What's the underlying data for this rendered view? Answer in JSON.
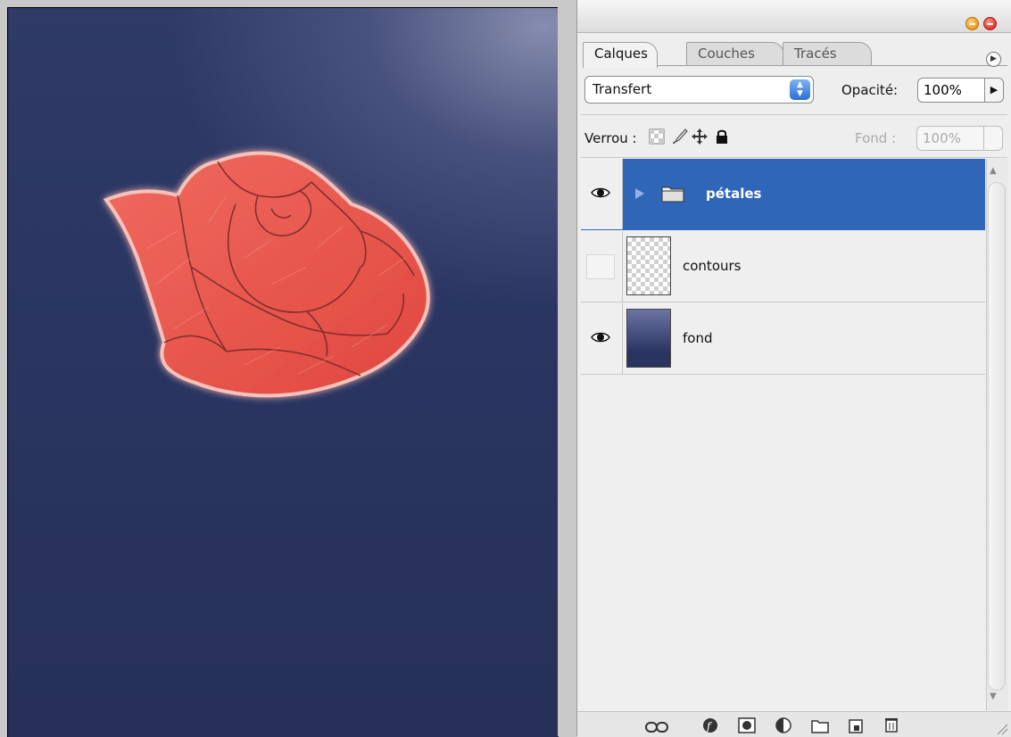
{
  "panel": {
    "tabs": [
      {
        "label": "Calques",
        "active": true
      },
      {
        "label": "Couches",
        "active": false
      },
      {
        "label": "Tracés",
        "active": false
      }
    ],
    "blend_mode": "Transfert",
    "opacity_label": "Opacité:",
    "opacity_value": "100%",
    "lock_label": "Verrou :",
    "fill_label": "Fond :",
    "fill_value": "100%",
    "layers": [
      {
        "name": "pétales",
        "type": "group",
        "visible": true,
        "selected": true
      },
      {
        "name": "contours",
        "type": "layer",
        "visible": false,
        "selected": false
      },
      {
        "name": "fond",
        "type": "layer",
        "visible": true,
        "selected": false
      }
    ]
  },
  "colors": {
    "selection": "#2f66b8",
    "canvas_background": "#2a3561",
    "rose": "#e85a52",
    "minimize_button": "#f39a1a",
    "close_button": "#e5352a"
  },
  "icons": {
    "lock_icons": [
      "lock-transparent-icon",
      "lock-paint-icon",
      "lock-move-icon",
      "lock-all-icon"
    ],
    "toolbar_icons": [
      "link-icon",
      "layer-style-icon",
      "layer-mask-icon",
      "adjustment-layer-icon",
      "new-group-icon",
      "new-layer-icon",
      "trash-icon"
    ]
  }
}
